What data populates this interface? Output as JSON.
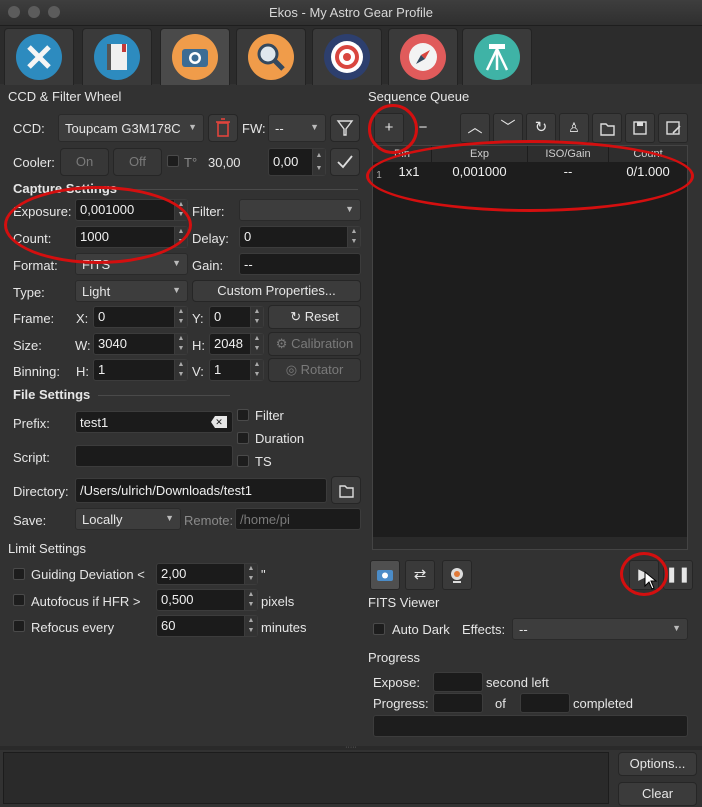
{
  "window": {
    "title": "Ekos - My Astro Gear Profile"
  },
  "tabs": [
    {
      "name": "setup",
      "icon": "wrench-screwdriver-icon",
      "color": "#2d8bbf"
    },
    {
      "name": "scheduler",
      "icon": "notebook-icon",
      "color": "#2d8bbf"
    },
    {
      "name": "capture",
      "icon": "camera-icon",
      "color": "#f09c4a"
    },
    {
      "name": "focus",
      "icon": "magnifier-icon",
      "color": "#f09c4a"
    },
    {
      "name": "align",
      "icon": "target-icon",
      "color": "#2d3f6e"
    },
    {
      "name": "guide",
      "icon": "compass-icon",
      "color": "#e05b5b"
    },
    {
      "name": "mount",
      "icon": "tripod-icon",
      "color": "#3fb3a6"
    }
  ],
  "ccd": {
    "section_title": "CCD & Filter Wheel",
    "ccd_label": "CCD:",
    "ccd_value": "Toupcam G3M178C",
    "fw_label": "FW:",
    "fw_value": "--",
    "cooler_label": "Cooler:",
    "on_label": "On",
    "off_label": "Off",
    "temp_label": "T°",
    "temp_value": "30,00",
    "temp_setpoint": "0,00"
  },
  "capture": {
    "title": "Capture Settings",
    "exposure_label": "Exposure:",
    "exposure_value": "0,001000",
    "filter_label": "Filter:",
    "filter_value": "",
    "count_label": "Count:",
    "count_value": "1000",
    "delay_label": "Delay:",
    "delay_value": "0",
    "format_label": "Format:",
    "format_value": "FITS",
    "gain_label": "Gain:",
    "gain_value": "--",
    "type_label": "Type:",
    "type_value": "Light",
    "custom_props": "Custom Properties...",
    "frame_label": "Frame:",
    "x_label": "X:",
    "x_value": "0",
    "y_label": "Y:",
    "y_value": "0",
    "reset_label": "Reset",
    "size_label": "Size:",
    "w_label": "W:",
    "w_value": "3040",
    "h_label": "H:",
    "h_value": "2048",
    "calibration_label": "Calibration",
    "binning_label": "Binning:",
    "binh_label": "H:",
    "binh_value": "1",
    "binv_label": "V:",
    "binv_value": "1",
    "rotator_label": "Rotator"
  },
  "file": {
    "title": "File Settings",
    "prefix_label": "Prefix:",
    "prefix_value": "test1",
    "filter_chk": "Filter",
    "duration_chk": "Duration",
    "ts_chk": "TS",
    "script_label": "Script:",
    "script_value": "",
    "directory_label": "Directory:",
    "directory_value": "/Users/ulrich/Downloads/test1",
    "save_label": "Save:",
    "save_value": "Locally",
    "remote_label": "Remote:",
    "remote_placeholder": "/home/pi"
  },
  "limits": {
    "title": "Limit Settings",
    "guiding_label": "Guiding Deviation <",
    "guiding_value": "2,00",
    "guiding_unit": "\"",
    "autofocus_label": "Autofocus if HFR >",
    "autofocus_value": "0,500",
    "autofocus_unit": "pixels",
    "refocus_label": "Refocus every",
    "refocus_value": "60",
    "refocus_unit": "minutes"
  },
  "queue": {
    "title": "Sequence Queue",
    "columns": [
      "Bin",
      "Exp",
      "ISO/Gain",
      "Count"
    ],
    "rows": [
      {
        "index": "1",
        "bin": "1x1",
        "exp": "0,001000",
        "gain": "--",
        "count": "0/1.000"
      }
    ]
  },
  "fits": {
    "title": "FITS Viewer",
    "auto_dark": "Auto Dark",
    "effects_label": "Effects:",
    "effects_value": "--"
  },
  "progress": {
    "title": "Progress",
    "expose_label": "Expose:",
    "second_left": "second left",
    "progress_label": "Progress:",
    "of_label": "of",
    "completed_label": "completed"
  },
  "bottom": {
    "options_label": "Options...",
    "clear_label": "Clear"
  },
  "colors": {
    "highlight": "#d40f0f"
  }
}
